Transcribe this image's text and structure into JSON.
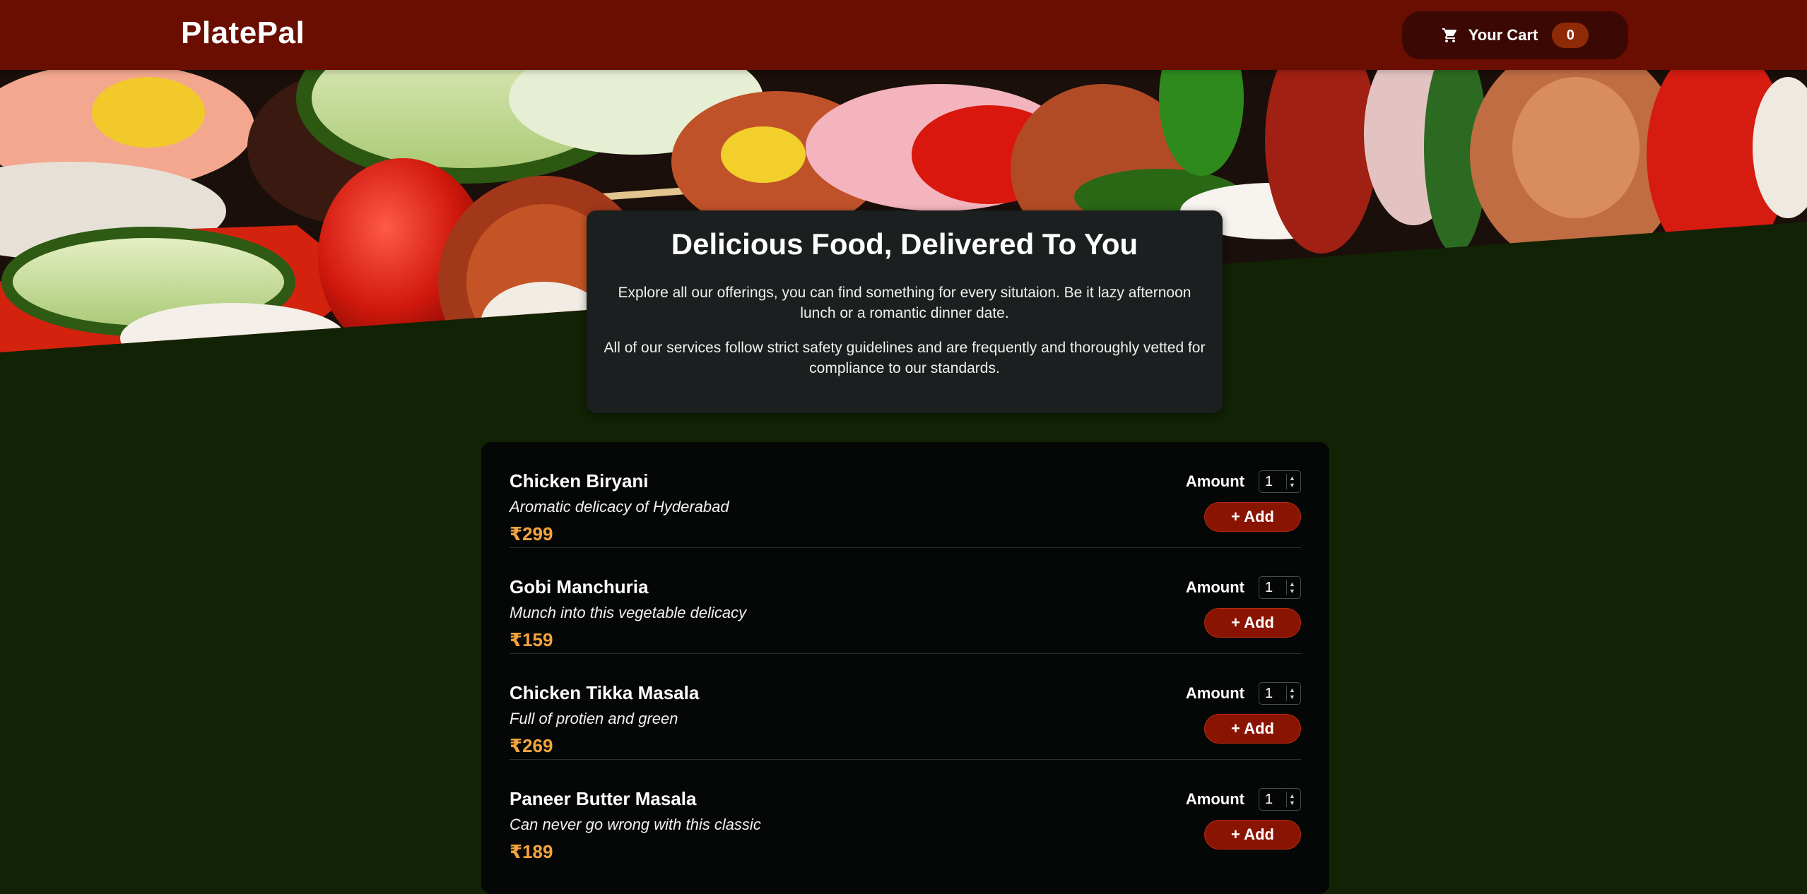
{
  "header": {
    "brand": "PlatePal",
    "cart": {
      "label": "Your Cart",
      "count": "0",
      "icon": "shopping-cart-icon"
    }
  },
  "hero": {
    "image": "kebab-skewers-photo"
  },
  "summary": {
    "title": "Delicious Food, Delivered To You",
    "paragraph1": "Explore all our offerings, you can find something for every situtaion. Be it lazy afternoon lunch or a romantic dinner date.",
    "paragraph2": "All of our services follow strict safety guidelines and are frequently and thoroughly vetted for compliance to our standards."
  },
  "meals": [
    {
      "name": "Chicken Biryani",
      "description": "Aromatic delicacy of Hyderabad",
      "price": "₹299",
      "amount_label": "Amount",
      "amount": "1",
      "add_label": "+ Add"
    },
    {
      "name": "Gobi Manchuria",
      "description": "Munch into this vegetable delicacy",
      "price": "₹159",
      "amount_label": "Amount",
      "amount": "1",
      "add_label": "+ Add"
    },
    {
      "name": "Chicken Tikka Masala",
      "description": "Full of protien and green",
      "price": "₹269",
      "amount_label": "Amount",
      "amount": "1",
      "add_label": "+ Add"
    },
    {
      "name": "Paneer Butter Masala",
      "description": "Can never go wrong with this classic",
      "price": "₹189",
      "amount_label": "Amount",
      "amount": "1",
      "add_label": "+ Add"
    }
  ],
  "colors": {
    "header": "#6b0e02",
    "background": "#122204",
    "price": "#f5a43c",
    "button": "#8a1402",
    "card": "#1c1f1f"
  }
}
